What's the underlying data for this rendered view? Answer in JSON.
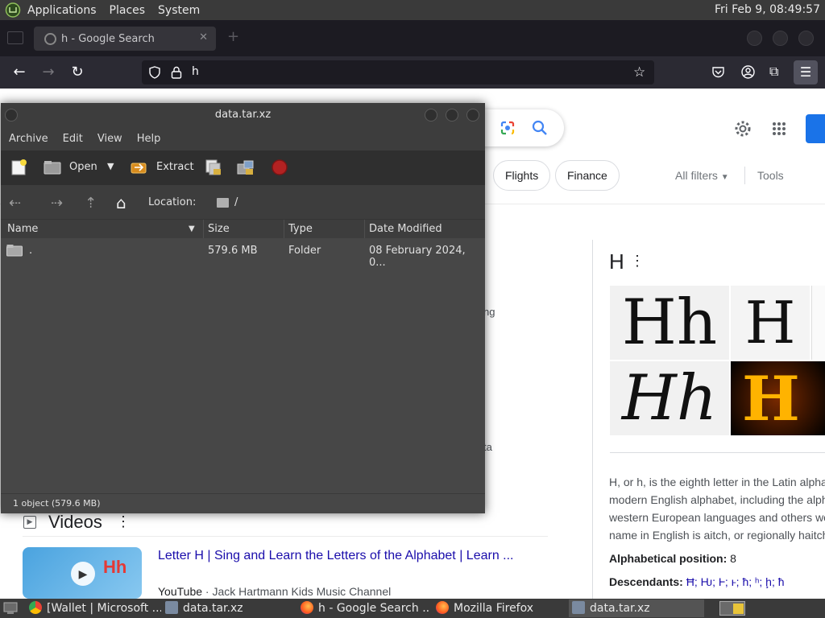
{
  "top_panel": {
    "menus": [
      "Applications",
      "Places",
      "System"
    ],
    "clock": "Fri Feb  9, 08:49:57"
  },
  "firefox": {
    "tab_title": "h - Google Search",
    "url": "h"
  },
  "google": {
    "chips": [
      "Flights",
      "Finance"
    ],
    "all_filters": "All filters",
    "tools": "Tools",
    "fragments": [
      "ng",
      "ta"
    ],
    "kp_title": "H",
    "kp_images": [
      "Hh",
      "H",
      "Hh",
      "H"
    ],
    "kp_description": [
      "H, or h, is the eighth letter in the Latin alpha",
      "modern English alphabet, including the alph",
      "western European languages and others wo",
      "name in English is aitch, or regionally haitch"
    ],
    "alphabetical_position_label": "Alphabetical position:",
    "alphabetical_position_value": "8",
    "descendants_label": "Descendants:",
    "descendants_value": "Ħ; Ƕ; Ⱶ; ⱶ; ħ; ʰ; ḩ; ħ",
    "videos_heading": "Videos",
    "video_title": "Letter H | Sing and Learn the Letters of the Alphabet | Learn ...",
    "video_source": "YouTube",
    "video_channel": "· Jack Hartmann Kids Music Channel",
    "video_thumb_text": "Hh"
  },
  "archive_manager": {
    "title": "data.tar.xz",
    "menus": [
      "Archive",
      "Edit",
      "View",
      "Help"
    ],
    "toolbar": {
      "open": "Open",
      "extract": "Extract"
    },
    "location_label": "Location:",
    "location_value": "/",
    "columns": [
      "Name",
      "Size",
      "Type",
      "Date Modified"
    ],
    "rows": [
      {
        "name": ".",
        "size": "579.6 MB",
        "type": "Folder",
        "date": "08 February 2024, 0..."
      }
    ],
    "status": "1 object (579.6 MB)"
  },
  "taskbar": {
    "tasks": [
      "[Wallet | Microsoft ...",
      "data.tar.xz",
      "h - Google Search ...",
      "Mozilla Firefox",
      "data.tar.xz"
    ]
  }
}
